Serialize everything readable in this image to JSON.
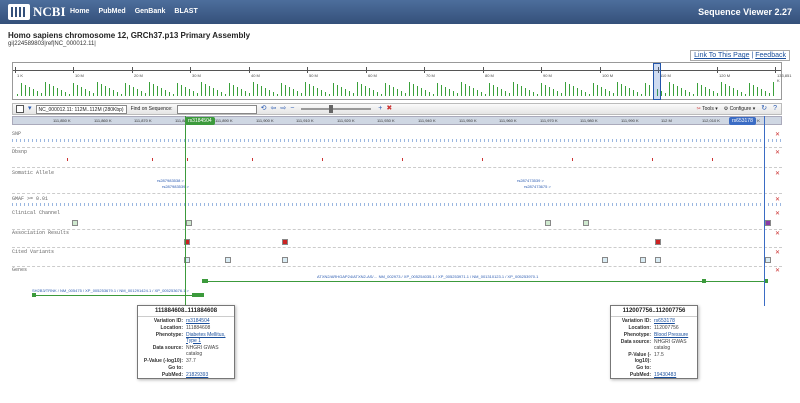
{
  "header": {
    "logo": "NCBI",
    "nav": [
      "Home",
      "PubMed",
      "GenBank",
      "BLAST"
    ],
    "app_title": "Sequence Viewer 2.27"
  },
  "page": {
    "title": "Homo sapiens chromosome 12, GRCh37.p13 Primary Assembly",
    "subtitle": "gi|224589803|ref|NC_000012.11|"
  },
  "links": {
    "link": "Link To This Page",
    "separator": "|",
    "feedback": "Feedback"
  },
  "overview": {
    "labels": [
      "1 K",
      "10 M",
      "20 M",
      "30 M",
      "40 M",
      "50 M",
      "60 M",
      "70 M",
      "80 M",
      "90 M",
      "100 M",
      "110 M",
      "120 M",
      "133,851 K"
    ]
  },
  "toolbar": {
    "sequence": "NC_000012.11: 112M..112M (280Kbp)",
    "find_label": "Find on Sequence:",
    "find_placeholder": "",
    "tools": "Tools",
    "configure": "Configure"
  },
  "ruler": {
    "labels": [
      "111,850 K",
      "111,860 K",
      "111,870 K",
      "111,880 K",
      "111,890 K",
      "111,900 K",
      "111,910 K",
      "111,920 K",
      "111,930 K",
      "111,940 K",
      "111,950 K",
      "111,960 K",
      "111,970 K",
      "111,980 K",
      "111,990 K",
      "112 M",
      "112,010 K",
      "112,020 K"
    ],
    "badge_left": "rs3184504",
    "badge_right": "rs653178"
  },
  "tracks": {
    "snp": "SNP",
    "dbsnp": "Dbsnp",
    "somatic": "Somatic Allele",
    "gmaf": "GMAF >= 0.01",
    "clinical": "Clinical Channel",
    "association": "Association Results",
    "cited": "Cited Variants",
    "genes": "Genes"
  },
  "somatic_labels": [
    "rs287983538 >",
    "rs287983539 >",
    "rs287473539 >",
    "rs287473675 >"
  ],
  "gene_labels": {
    "top": "ATXN2/ARHGAP24/ATXN2-AS/… NM_002973 / XP_005254035.1 / XP_005253971.1 / NM_001310123.1 / XP_005253970.1",
    "left": "SH2B3/TRNK / NM_005475 / XP_005253679.1 / NM_001291424.1 / XP_005253676.1 >"
  },
  "popup_left": {
    "title": "111884608..111884608",
    "rows": [
      {
        "k": "Variation ID:",
        "v": "rs3184504",
        "link": true
      },
      {
        "k": "Location:",
        "v": "111884608",
        "link": false
      },
      {
        "k": "Phenotype:",
        "v": "Diabetes Mellitus, Type 1",
        "link": true
      },
      {
        "k": "Data source:",
        "v": "NHGRI GWAS catalog",
        "link": false
      },
      {
        "k": "P-Value (-log10):",
        "v": "37.7",
        "link": false
      },
      {
        "k": "Go to:",
        "v": "",
        "link": false
      },
      {
        "k": "PubMed:",
        "v": "21829393",
        "link": true
      }
    ]
  },
  "popup_right": {
    "title": "112007756..112007756",
    "rows": [
      {
        "k": "Variation ID:",
        "v": "rs653178",
        "link": true
      },
      {
        "k": "Location:",
        "v": "112007756",
        "link": false
      },
      {
        "k": "Phenotype:",
        "v": "Blood Pressure",
        "link": true
      },
      {
        "k": "Data source:",
        "v": "NHGRI GWAS catalog",
        "link": false
      },
      {
        "k": "P-Value (-log10):",
        "v": "17.5",
        "link": false
      },
      {
        "k": "Go to:",
        "v": "",
        "link": false
      },
      {
        "k": "PubMed:",
        "v": "19430483",
        "link": true
      }
    ]
  },
  "colors": {
    "header": "#34507a",
    "gene": "#3c9a3c",
    "assoc_red": "#cc2222",
    "link": "#1a4f9c"
  }
}
